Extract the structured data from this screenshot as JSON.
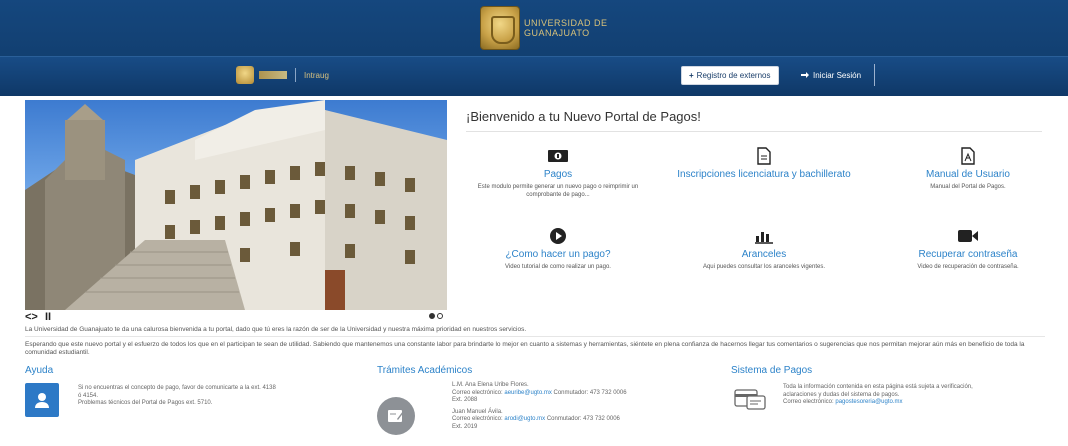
{
  "header": {
    "brand_line1": "UNIVERSIDAD DE",
    "brand_line2": "GUANAJUATO",
    "intraug_label": "Intraug",
    "registro_label": "Registro de externos",
    "login_label": "Iniciar Sesión"
  },
  "carousel": {
    "prev_next_label": "<>",
    "pause_label": "II"
  },
  "welcome": {
    "title": "¡Bienvenido a tu Nuevo Portal de Pagos!",
    "tiles": [
      {
        "icon": "money-icon",
        "title": "Pagos",
        "desc": "Este modulo permite generar un nuevo pago o reimprimir un comprobante de pago..."
      },
      {
        "icon": "document-icon",
        "title": "Inscripciones licenciatura y bachillerato",
        "desc": ""
      },
      {
        "icon": "pdf-icon",
        "title": "Manual de Usuario",
        "desc": "Manual del Portal de Pagos."
      },
      {
        "icon": "play-icon",
        "title": "¿Como hacer un pago?",
        "desc": "Video tutorial de como realizar un pago."
      },
      {
        "icon": "bar-chart-icon",
        "title": "Aranceles",
        "desc": "Aqui puedes consultar los aranceles vigentes."
      },
      {
        "icon": "video-camera-icon",
        "title": "Recuperar contraseña",
        "desc": "Video de recuperación de contraseña."
      }
    ]
  },
  "paragraphs": {
    "p1": "La Universidad de Guanajuato te da una calurosa bienvenida a tu portal, dado que tú eres la razón de ser de la Universidad y nuestra máxima prioridad en nuestros servicios.",
    "p2": "Esperando que este nuevo portal y el esfuerzo de todos los que en el participan te sean de utilidad. Sabiendo que mantenemos una constante labor para brindarte lo mejor en cuanto a sistemas y herramientas, siéntete en plena confianza de hacernos llegar tus comentarios o sugerencias que nos permitan mejorar aún más en beneficio de toda la comunidad estudiantil."
  },
  "footer": {
    "ayuda": {
      "heading": "Ayuda",
      "line1": "Si no encuentras el concepto de pago, favor de comunicarte a la ext. 4138",
      "line2": "ó 4154.",
      "line3": "Problemas técnicos del Portal de Pagos ext. 5710."
    },
    "tramites": {
      "heading": "Trámites Académicos",
      "c1_name": "L.M. Ana Elena Uribe Flores.",
      "c1_email_label": "Correo electrónico:",
      "c1_email": "aeuribe@ugto.mx",
      "c1_phone": "Conmutador: 473 732 0006",
      "c1_ext": "Ext. 2088",
      "c2_name": "Juan Manuel Ávila.",
      "c2_email_label": "Correo electrónico:",
      "c2_email": "arodi@ugto.mx",
      "c2_phone": "Conmutador: 473 732 0006",
      "c2_ext": "Ext. 2019"
    },
    "sistema": {
      "heading": "Sistema de Pagos",
      "line1": "Toda la información contenida en esta página está sujeta a verificación,",
      "line2": "aclaraciones y dudas del sistema de pagos.",
      "email_label": "Correo electrónico:",
      "email": "pagostesoreria@ugto.mx"
    }
  }
}
